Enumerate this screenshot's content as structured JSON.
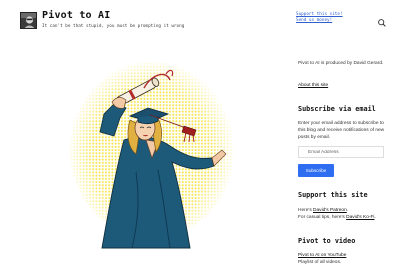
{
  "header": {
    "title": "Pivot to AI",
    "tagline": "It can't be that stupid, you must be prompting it wrong",
    "support_link": "Support this site! Send us money!",
    "search_icon": "search-icon",
    "logo_icon": "logo-portrait-icon"
  },
  "hero": {
    "icon": "graduate-pop-art-illustration",
    "colors": {
      "halftone": "#f4e13a",
      "gown": "#1d5a7a",
      "tassel": "#a01e1e",
      "hair": "#e0b040"
    }
  },
  "sidebar": {
    "intro": "Pivot to AI is produced by David Gerard.",
    "about_link": "About this site",
    "subscribe_heading": "Subscribe via email",
    "subscribe_text": "Enter your email address to subscribe to this blog and receive notifications of new posts by email.",
    "email_placeholder": "Email Address",
    "subscribe_button": "Subscribe",
    "support_heading": "Support this site",
    "support_line1_prefix": "Here's ",
    "support_line1_link": "David's Patreon",
    "support_line1_suffix": ".",
    "support_line2_prefix": "For casual tips, here's ",
    "support_line2_link": "David's Ko-Fi",
    "support_line2_suffix": ".",
    "video_heading": "Pivot to video",
    "video_link": "Pivot to AI on YouTube",
    "video_text": "Playlist of all videos."
  },
  "colors": {
    "accent": "#2f6ef0",
    "link": "#2f5fd0",
    "text": "#1e1e1e"
  }
}
